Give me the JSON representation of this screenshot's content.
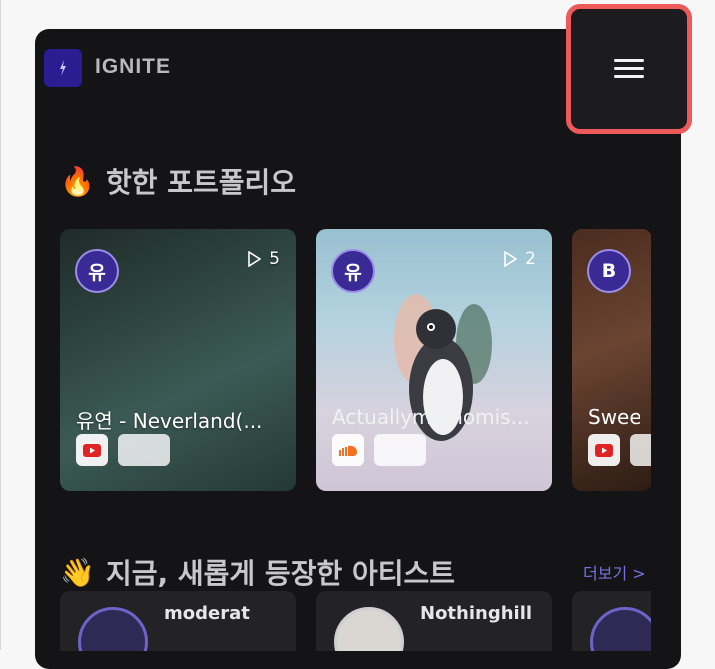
{
  "header": {
    "logo_text": "IGNITE",
    "menu_icon": "hamburger-menu-icon"
  },
  "hot_portfolio": {
    "emoji": "🔥",
    "title": "핫한 포트폴리오",
    "cards": [
      {
        "avatar_initial": "유",
        "play_count": "5",
        "title": "유연 - Neverland(...",
        "platform_icon": "youtube-icon"
      },
      {
        "avatar_initial": "유",
        "play_count": "2",
        "title": "Actuallymymomis...",
        "platform_icon": "soundcloud-icon"
      },
      {
        "avatar_initial": "B",
        "title": "Sweet",
        "platform_icon": "youtube-icon"
      }
    ]
  },
  "new_artists": {
    "emoji": "👋",
    "title": "지금, 새롭게 등장한 아티스트",
    "more_label": "더보기 >",
    "artists": [
      {
        "name": "moderat"
      },
      {
        "name": "Nothinghill"
      },
      {
        "name": ""
      }
    ]
  },
  "colors": {
    "accent": "#7b6fe0",
    "highlight_border": "#ee5959",
    "app_background": "#141416"
  }
}
